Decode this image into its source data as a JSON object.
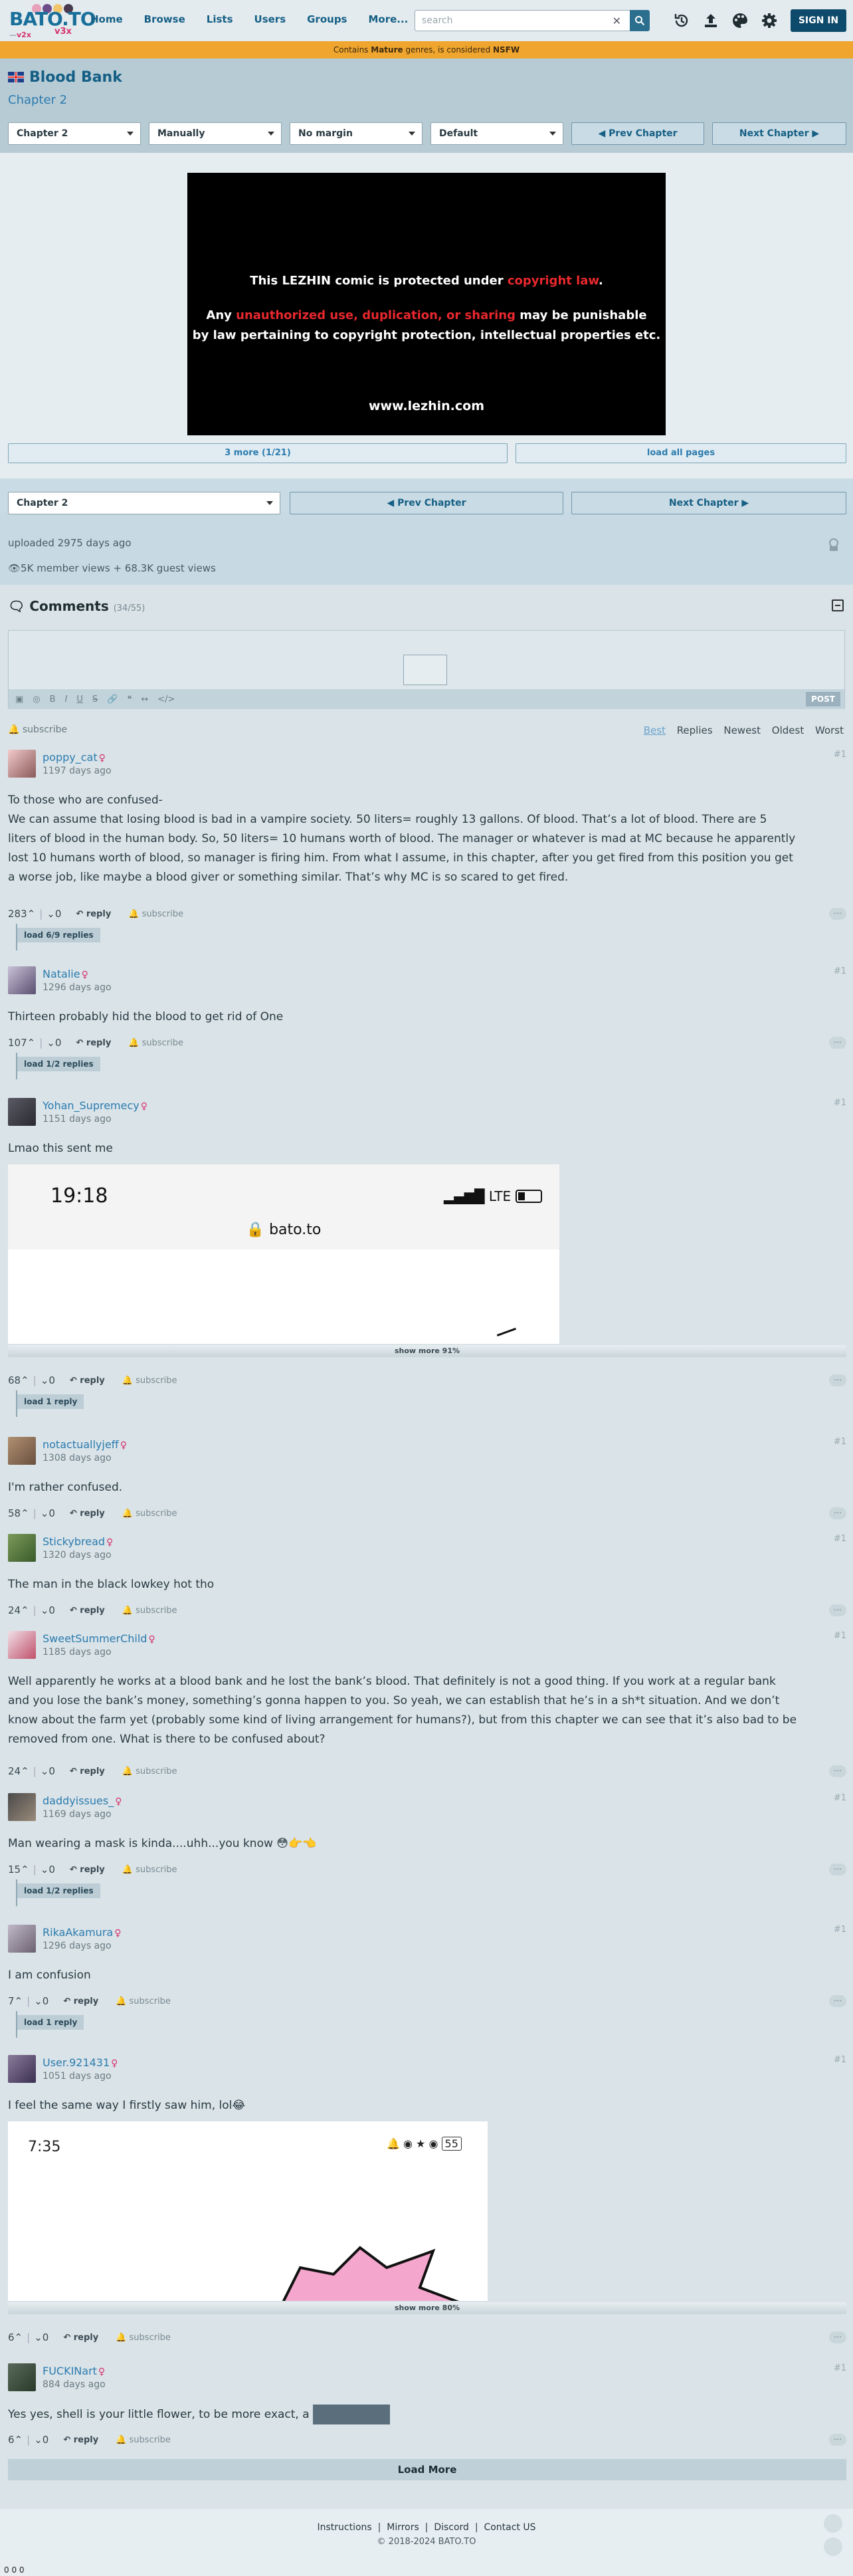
{
  "header": {
    "logo_text": "BATO.TO",
    "version": "v2x",
    "v3x": "v3x",
    "nav": [
      "Home",
      "Browse",
      "Lists",
      "Users",
      "Groups",
      "More..."
    ],
    "search_placeholder": "search",
    "signin": "SIGN IN"
  },
  "notice": {
    "prefix": "Contains ",
    "mature": "Mature",
    "mid": " genres, is considered ",
    "nsfw": "NSFW"
  },
  "title": {
    "name": "Blood Bank",
    "chapter": "Chapter 2"
  },
  "controls": {
    "chapter_select": "Chapter 2",
    "mode_select": "Manually",
    "margin_select": "No margin",
    "size_select": "Default",
    "prev": "◀ Prev Chapter",
    "next": "Next Chapter ▶"
  },
  "page_image": {
    "line1_a": "This LEZHIN comic is protected under ",
    "line1_b": "copyright law",
    "line1_c": ".",
    "line2_a": "Any ",
    "line2_b": "unauthorized use, duplication, or sharing",
    "line2_c": " may be punishable",
    "line3": "by law pertaining to copyright protection, intellectual properties etc.",
    "url": "www.lezhin.com"
  },
  "paging": {
    "more": "3 more (1/21)",
    "all": "load all pages"
  },
  "meta": {
    "uploaded": "uploaded 2975 days ago",
    "views": "5K member views + 68.3K guest views"
  },
  "comments": {
    "heading": "Comments",
    "count": "(34/55)",
    "post": "POST",
    "subscribe": "subscribe",
    "sorts": [
      "Best",
      "Replies",
      "Newest",
      "Oldest",
      "Worst"
    ],
    "reply_label": "reply",
    "sub_label": "subscribe",
    "items": [
      {
        "user": "poppy_cat",
        "days": "1197 days ago",
        "num": "#1",
        "lines": [
          "To those who are confused-",
          "We can assume that losing blood is bad in a vampire society. 50 liters= roughly 13 gallons. Of blood. That’s a lot of blood. There are 5",
          "liters of blood in the human body. So, 50 liters= 10 humans worth of blood. The manager or whatever is mad at MC because he apparently",
          "lost 10 humans worth of blood, so manager is firing him. From what I assume, in this chapter, after you get fired from this position you get",
          "a worse job, like maybe a blood giver or something similar. That’s why MC is so scared to get fired."
        ],
        "up": "283",
        "down": "0",
        "load": "load 6/9 replies"
      },
      {
        "user": "Natalie",
        "days": "1296 days ago",
        "num": "#1",
        "lines": [
          "Thirteen probably hid the blood to get rid of One"
        ],
        "up": "107",
        "down": "0",
        "load": "load 1/2 replies"
      },
      {
        "user": "Yohan_Supremecy",
        "days": "1151 days ago",
        "num": "#1",
        "lines": [
          "Lmao this sent me"
        ],
        "up": "68",
        "down": "0",
        "load": "load 1 reply",
        "shot_time": "19:18",
        "shot_net": "LTE",
        "shot_url": "bato.to",
        "showmore": "show more 91%"
      },
      {
        "user": "notactuallyjeff",
        "days": "1308 days ago",
        "num": "#1",
        "lines": [
          "I'm rather confused."
        ],
        "up": "58",
        "down": "0"
      },
      {
        "user": "Stickybread",
        "days": "1320 days ago",
        "num": "#1",
        "lines": [
          "The man in the black lowkey hot tho"
        ],
        "up": "24",
        "down": "0"
      },
      {
        "user": "SweetSummerChild",
        "days": "1185 days ago",
        "num": "#1",
        "lines": [
          "Well apparently he works at a blood bank and he lost the bank’s blood. That definitely is not a good thing. If you work at a regular bank",
          "and you lose the bank’s money, something’s gonna happen to you. So yeah, we can establish that he’s in a sh*t situation. And we don’t",
          "know about the farm yet (probably some kind of living arrangement for humans?), but from this chapter we can see that it’s also bad to be",
          "removed from one. What is there to be confused about?"
        ],
        "up": "24",
        "down": "0"
      },
      {
        "user": "daddyissues_",
        "days": "1169 days ago",
        "num": "#1",
        "lines": [
          "Man wearing a mask is kinda....uhh...you know 😳👉👈"
        ],
        "up": "15",
        "down": "0",
        "load": "load 1/2 replies"
      },
      {
        "user": "RikaAkamura",
        "days": "1296 days ago",
        "num": "#1",
        "lines": [
          "I am confusion"
        ],
        "up": "7",
        "down": "0",
        "load": "load 1 reply"
      },
      {
        "user": "User.921431",
        "days": "1051 days ago",
        "num": "#1",
        "lines": [
          "I feel the same way I firstly saw him, lol😂"
        ],
        "up": "6",
        "down": "0",
        "shot_time": "7:35",
        "shot_battery": "55",
        "showmore": "show more 80%"
      },
      {
        "user": "FUCKINart",
        "days": "884 days ago",
        "num": "#1",
        "lines": [
          "Yes yes, shell is your little flower, to be more exact, a "
        ],
        "up": "6",
        "down": "0"
      }
    ],
    "load_more": "Load More"
  },
  "footer": {
    "links": [
      "Instructions",
      "Mirrors",
      "Discord",
      "Contact US"
    ],
    "copy": "© 2018-2024 BATO.TO"
  },
  "corner_counter": "0 0 0"
}
